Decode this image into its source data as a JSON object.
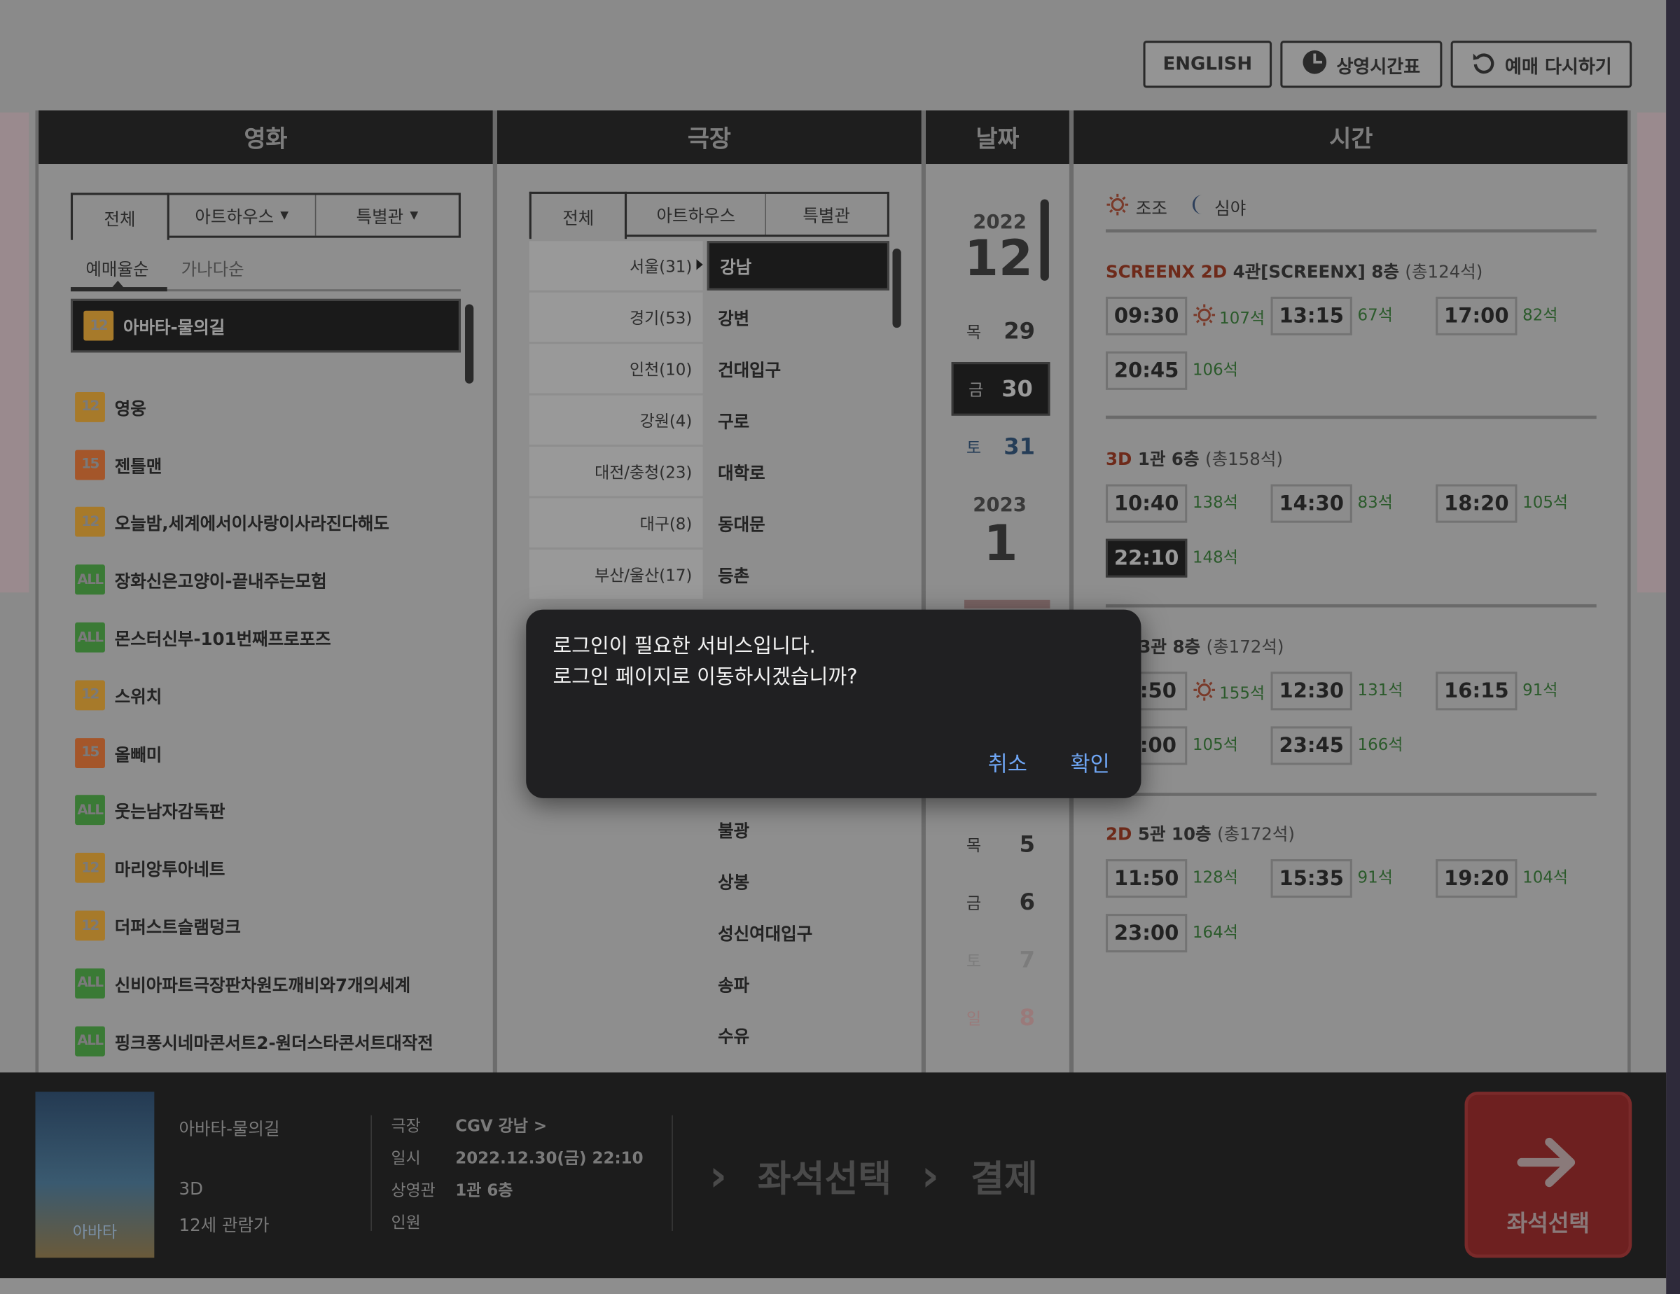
{
  "header": {
    "english_label": "ENGLISH",
    "timetable_label": "상영시간표",
    "reset_label": "예매 다시하기"
  },
  "columns": {
    "movie": "영화",
    "theater": "극장",
    "date": "날짜",
    "time": "시간"
  },
  "movie_panel": {
    "tabs": [
      "전체",
      "아트하우스",
      "특별관"
    ],
    "sort": [
      "예매율순",
      "가나다순"
    ],
    "movies": [
      {
        "rating": "12",
        "title": "아바타-물의길"
      },
      {
        "rating": "12",
        "title": "영웅"
      },
      {
        "rating": "15",
        "title": "젠틀맨"
      },
      {
        "rating": "12",
        "title": "오늘밤,세계에서이사랑이사라진다해도"
      },
      {
        "rating": "ALL",
        "title": "장화신은고양이-끝내주는모험"
      },
      {
        "rating": "ALL",
        "title": "몬스터신부-101번째프로포즈"
      },
      {
        "rating": "12",
        "title": "스위치"
      },
      {
        "rating": "15",
        "title": "올빼미"
      },
      {
        "rating": "ALL",
        "title": "웃는남자감독판"
      },
      {
        "rating": "12",
        "title": "마리앙투아네트"
      },
      {
        "rating": "12",
        "title": "더퍼스트슬램덩크"
      },
      {
        "rating": "ALL",
        "title": "신비아파트극장판차원도깨비와7개의세계"
      },
      {
        "rating": "ALL",
        "title": "핑크퐁시네마콘서트2-원더스타콘서트대작전"
      }
    ]
  },
  "theater_panel": {
    "tabs": [
      "전체",
      "아트하우스",
      "특별관"
    ],
    "regions": [
      "서울(31)",
      "경기(53)",
      "인천(10)",
      "강원(4)",
      "대전/충청(23)",
      "대구(8)",
      "부산/울산(17)"
    ],
    "theaters_top": [
      "강남",
      "강변",
      "건대입구",
      "구로",
      "대학로",
      "동대문",
      "등촌"
    ],
    "theaters_bottom": [
      "불광",
      "상봉",
      "성신여대입구",
      "송파",
      "수유"
    ]
  },
  "date_panel": {
    "year1": "2022",
    "month1": "12",
    "days1": [
      {
        "dow": "목",
        "day": "29"
      },
      {
        "dow": "금",
        "day": "30"
      },
      {
        "dow": "토",
        "day": "31"
      }
    ],
    "year2": "2023",
    "month2": "1",
    "days2": [
      {
        "dow": "목",
        "day": "5"
      },
      {
        "dow": "금",
        "day": "6"
      },
      {
        "dow": "토",
        "day": "7"
      },
      {
        "dow": "일",
        "day": "8"
      }
    ]
  },
  "time_panel": {
    "legend_morning": "조조",
    "legend_night": "심야",
    "sections": [
      {
        "format": "SCREENX 2D",
        "hall": "4관[SCREENX] 8층",
        "total": "(총124석)",
        "times": [
          [
            "09:30",
            "107석"
          ],
          [
            "13:15",
            "67석"
          ],
          [
            "17:00",
            "82석"
          ],
          [
            "20:45",
            "106석"
          ]
        ]
      },
      {
        "format": "3D",
        "hall": "1관 6층",
        "total": "(총158석)",
        "times": [
          [
            "10:40",
            "138석"
          ],
          [
            "14:30",
            "83석"
          ],
          [
            "18:20",
            "105석"
          ],
          [
            "22:10",
            "148석"
          ]
        ]
      },
      {
        "hall": "3관 8층",
        "total": "(총172석)",
        "times": [
          [
            ":50",
            "155석"
          ],
          [
            "12:30",
            "131석"
          ],
          [
            "16:15",
            "91석"
          ],
          [
            ":00",
            "105석"
          ],
          [
            "23:45",
            "166석"
          ]
        ]
      },
      {
        "format": "2D",
        "hall": "5관 10층",
        "total": "(총172석)",
        "times": [
          [
            "11:50",
            "128석"
          ],
          [
            "15:35",
            "91석"
          ],
          [
            "19:20",
            "104석"
          ],
          [
            "23:00",
            "164석"
          ]
        ]
      }
    ]
  },
  "bottom_bar": {
    "movie_title": "아바타-물의길",
    "format": "3D",
    "rating": "12세 관람가",
    "labels": {
      "theater": "극장",
      "date": "일시",
      "hall": "상영관",
      "people": "인원"
    },
    "values": {
      "theater": "CGV 강남 >",
      "date": "2022.12.30(금) 22:10",
      "hall": "1관 6층"
    },
    "step_seat": "좌석선택",
    "step_pay": "결제",
    "next_label": "좌석선택",
    "poster_title": "아바타"
  },
  "dialog": {
    "line1": "로그인이 필요한 서비스입니다.",
    "line2": "로그인 페이지로 이동하시겠습니까?",
    "cancel": "취소",
    "ok": "확인"
  }
}
